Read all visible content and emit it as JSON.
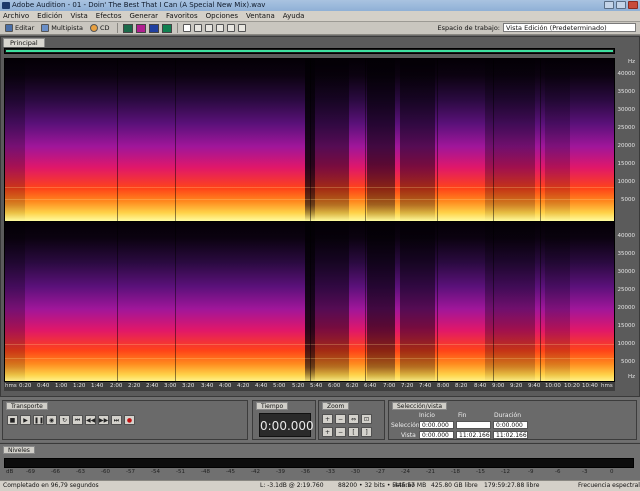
{
  "window": {
    "title": "Adobe Audition - 01 - Doin' The Best That I Can (A Special New Mix).wav"
  },
  "menu": [
    "Archivo",
    "Edición",
    "Vista",
    "Efectos",
    "Generar",
    "Favoritos",
    "Opciones",
    "Ventana",
    "Ayuda"
  ],
  "toolbar": {
    "editar": "Editar",
    "multipista": "Multipista",
    "cd": "CD",
    "workspace_label": "Espacio de trabajo:",
    "workspace_value": "Vista Edición (Predeterminado)"
  },
  "main": {
    "tab": "Principal"
  },
  "freq_labels_ch1": [
    "Hz",
    "40000",
    "35000",
    "30000",
    "25000",
    "20000",
    "15000",
    "10000",
    "5000"
  ],
  "freq_labels_ch2": [
    "40000",
    "35000",
    "30000",
    "25000",
    "20000",
    "15000",
    "10000",
    "5000",
    "Hz"
  ],
  "time_labels": [
    "hms",
    "0:20",
    "0:40",
    "1:00",
    "1:20",
    "1:40",
    "2:00",
    "2:20",
    "2:40",
    "3:00",
    "3:20",
    "3:40",
    "4:00",
    "4:20",
    "4:40",
    "5:00",
    "5:20",
    "5:40",
    "6:00",
    "6:20",
    "6:40",
    "7:00",
    "7:20",
    "7:40",
    "8:00",
    "8:20",
    "8:40",
    "9:00",
    "9:20",
    "9:40",
    "10:00",
    "10:20",
    "10:40",
    "hms"
  ],
  "transport": {
    "tab": "Transporte"
  },
  "time": {
    "tab": "Tiempo",
    "value": "0:00.000"
  },
  "zoom": {
    "tab": "Zoom"
  },
  "selection": {
    "tab": "Selección/vista",
    "col_inicio": "Inicio",
    "col_fin": "Fin",
    "col_duracion": "Duración",
    "row_seleccion": "Selección",
    "row_vista": "Vista",
    "sel_inicio": "0:00.000",
    "sel_fin": "",
    "sel_duracion": "0:00.000",
    "vista_inicio": "0:00.000",
    "vista_fin": "11:02.166",
    "vista_duracion": "11:02.166"
  },
  "levels": {
    "tab": "Niveles",
    "scale": [
      "dB",
      "-69",
      "-66",
      "-63",
      "-60",
      "-57",
      "-54",
      "-51",
      "-48",
      "-45",
      "-42",
      "-39",
      "-36",
      "-33",
      "-30",
      "-27",
      "-24",
      "-21",
      "-18",
      "-15",
      "-12",
      "-9",
      "-6",
      "-3",
      "0"
    ]
  },
  "status": {
    "completed": "Completado en 96,79 segundos",
    "level": "L: -3.1dB @ 2:19.760",
    "format": "88200 • 32 bits • Estéreo",
    "filesize": "445.57 MB",
    "free": "425.80 GB libre",
    "free_time": "179:59:27.88 libre",
    "view": "Frecuencia espectral"
  }
}
